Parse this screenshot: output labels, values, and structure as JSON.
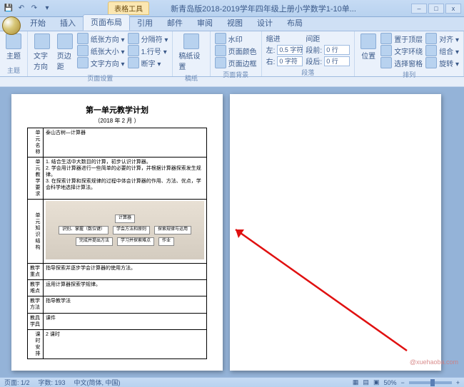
{
  "titlebar": {
    "table_tools": "表格工具",
    "doc_title": "新青岛版2018-2019学年四年级上册小学数学1-10单..."
  },
  "wincontrols": {
    "min": "–",
    "max": "□",
    "close": "x"
  },
  "tabs": {
    "start": "开始",
    "insert": "插入",
    "page_layout": "页面布局",
    "references": "引用",
    "mail": "邮件",
    "review": "审阅",
    "view": "视图",
    "design": "设计",
    "layout": "布局"
  },
  "ribbon": {
    "themes": {
      "label": "主题",
      "btn": "主题"
    },
    "page_setup": {
      "label": "页面设置",
      "orientation": "文字方向",
      "margins": "页边距",
      "row1": "纸张方向 ▾",
      "row2": "纸张大小 ▾",
      "row3": "文字方向 ▾",
      "col1": "分隔符 ▾",
      "col2": "1.行号 ▾",
      "col3": "断字 ▾"
    },
    "paperbg": {
      "label": "稿纸",
      "btn": "稿纸设置"
    },
    "page_bg": {
      "label": "页面背景",
      "watermark": "水印",
      "color": "页面颜色",
      "border": "页面边框"
    },
    "paragraph": {
      "label": "段落",
      "indent": "缩进",
      "indent_left": "左:",
      "indent_right": "右:",
      "indent_left_val": "0.5 字符",
      "indent_right_val": "0 字符",
      "spacing": "间距",
      "before": "段前:",
      "after": "段后:",
      "before_val": "0 行",
      "after_val": "0 行"
    },
    "arrange": {
      "label": "排列",
      "pos": "位置",
      "front": "置于顶层",
      "wrap": "文字环绕",
      "pane": "选择窗格",
      "align": "对齐 ▾",
      "group": "组合 ▾",
      "rotate": "旋转 ▾"
    }
  },
  "doc": {
    "title": "第一单元教学计划",
    "date": "（2018 年 2 月  ）",
    "unit_label": "单元名称",
    "unit_value": "泰山古树—计算器",
    "goals_label": "单元教学要求",
    "goals": "1. 结合生活中大数目的计算，初步认识计算器。\n2. 学会用计算器进行一些简单的必要的计算，并根据计算器探索发生规律。\n3. 在探索计算和探索规律的过程中体会计算器的作用、方法、优点，学会科学地选择计算法。",
    "struct_label": "单元知识结构",
    "photo": {
      "center": "计算器",
      "r1a": "识别、掌握（数位键）",
      "r1b": "学会方法和原则",
      "r1c": "探索规律与运用",
      "r2a": "完成并提出方法",
      "r2b": "学习并探索难点",
      "r2c": "作业"
    },
    "keypoint_label": "教学重点",
    "keypoint": "指导探索并逐步学会计算器的使用方法。",
    "diff_label": "教学难点",
    "diff": "运用计算器探索学规律。",
    "method_label": "教学方法",
    "method": "指导教学法",
    "tool_label": "教具 学具",
    "tool": "课件",
    "hours_label": "课时安排",
    "hours": "2 课时"
  },
  "status": {
    "page": "页面: 1/2",
    "words": "字数: 193",
    "lang": "中文(简体, 中国)",
    "zoom": "50%",
    "watermark": "@xuehaoba.com"
  }
}
